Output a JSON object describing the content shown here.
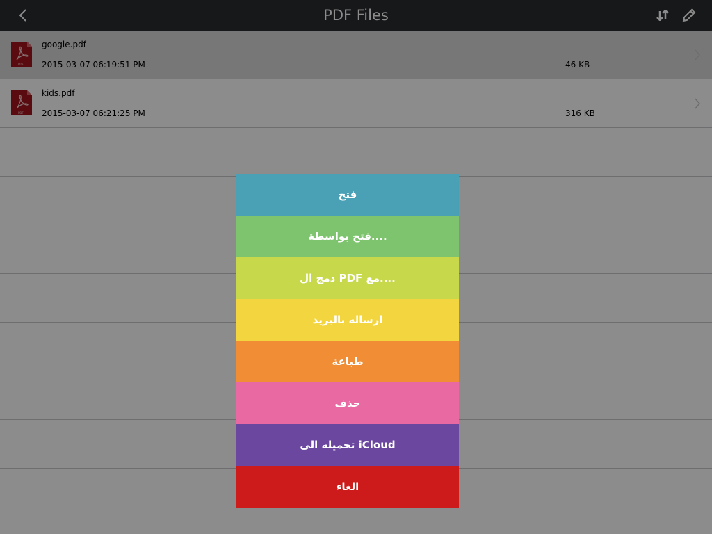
{
  "navbar": {
    "title": "PDF Files",
    "back_icon": "chevron-left-icon",
    "sort_icon": "sort-arrows-icon",
    "edit_icon": "pencil-icon"
  },
  "files": [
    {
      "name": "google.pdf",
      "date": "2015-03-07 06:19:51 PM",
      "size": "46 KB",
      "icon": "pdf-file-icon"
    },
    {
      "name": "kids.pdf",
      "date": "2015-03-07 06:21:25 PM",
      "size": "316 KB",
      "icon": "pdf-file-icon"
    }
  ],
  "action_sheet": {
    "actions": [
      {
        "label": "فتح",
        "color": "#4aa0b5"
      },
      {
        "label": "فتح بواسطة....",
        "color": "#7ec46e"
      },
      {
        "label": "دمج ال PDF مع....",
        "color": "#c7d84a"
      },
      {
        "label": "ارساله بالبريد",
        "color": "#f3d63f"
      },
      {
        "label": "طباعة",
        "color": "#f08d35"
      },
      {
        "label": "حذف",
        "color": "#e96aa2"
      },
      {
        "label": "تحميله الى iCloud",
        "color": "#6b47a0"
      },
      {
        "label": "الغاء",
        "color": "#cd1b1b"
      }
    ]
  },
  "colors": {
    "navbar_bg": "#2a2c2e",
    "pdf_icon_red": "#a3151c"
  }
}
